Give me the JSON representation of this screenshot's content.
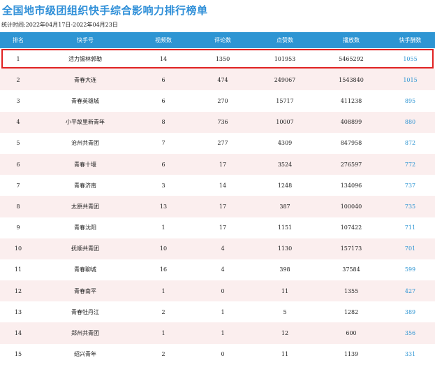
{
  "title": "全国地市级团组织快手综合影响力排行榜单",
  "period": "统计时间:2022年04月17日-2022年04月23日",
  "columns": [
    "排名",
    "快手号",
    "视频数",
    "评论数",
    "点赞数",
    "播放数",
    "快手酬数"
  ],
  "rows": [
    [
      "1",
      "活力锡林郭勒",
      "14",
      "1350",
      "101953",
      "5465292",
      "1055"
    ],
    [
      "2",
      "青春大连",
      "6",
      "474",
      "249067",
      "1543840",
      "1015"
    ],
    [
      "3",
      "青春英雄城",
      "6",
      "270",
      "15717",
      "411238",
      "895"
    ],
    [
      "4",
      "小平故里新青年",
      "8",
      "736",
      "10007",
      "408899",
      "880"
    ],
    [
      "5",
      "沧州共青团",
      "7",
      "277",
      "4309",
      "847958",
      "872"
    ],
    [
      "6",
      "青春十堰",
      "6",
      "17",
      "3524",
      "276597",
      "772"
    ],
    [
      "7",
      "青春济南",
      "3",
      "14",
      "1248",
      "134096",
      "737"
    ],
    [
      "8",
      "太原共青团",
      "13",
      "17",
      "387",
      "100040",
      "735"
    ],
    [
      "9",
      "青春沈阳",
      "1",
      "17",
      "1151",
      "107422",
      "711"
    ],
    [
      "10",
      "抚顺共青团",
      "10",
      "4",
      "1130",
      "157173",
      "701"
    ],
    [
      "11",
      "青春聊城",
      "16",
      "4",
      "398",
      "37584",
      "599"
    ],
    [
      "12",
      "青春南平",
      "1",
      "0",
      "11",
      "1355",
      "427"
    ],
    [
      "13",
      "青春牡丹江",
      "2",
      "1",
      "5",
      "1282",
      "389"
    ],
    [
      "14",
      "郑州共青团",
      "1",
      "1",
      "12",
      "600",
      "356"
    ],
    [
      "15",
      "绍兴青年",
      "2",
      "0",
      "11",
      "1139",
      "331"
    ]
  ],
  "colors": {
    "header_bg": "#2e95d3",
    "title": "#2f8fd8",
    "alt_row_bg": "#fbeeee",
    "highlight_border": "#e02020",
    "index_text": "#2e95d3"
  }
}
